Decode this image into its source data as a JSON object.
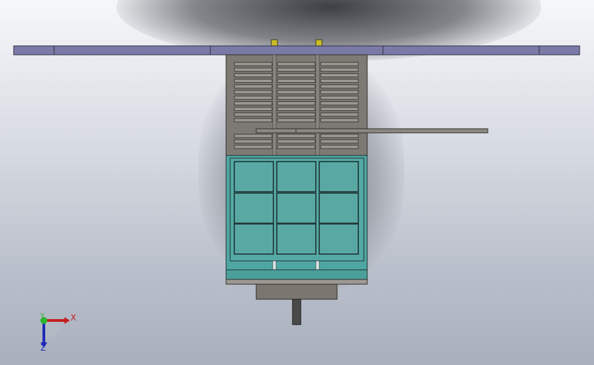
{
  "scene": {
    "type": "cad-model-view",
    "colors": {
      "solar_panel": "#7a7aa6",
      "panel_edge": "#2d2d44",
      "lid": "#7d7a74",
      "vent_slot": "#3b3b3b",
      "teal_body": "#4fa6a2",
      "teal_cell": "#5aa8a4",
      "cell_border": "#1e3332",
      "mount": "#7b7670",
      "connector": "#cbbd2a",
      "shaft": "#4a4a4a"
    },
    "vent_columns": 3,
    "cell_grid": {
      "rows": 3,
      "cols": 3
    }
  },
  "triad": {
    "x_label": "X",
    "y_label": "Y",
    "z_label": "Z",
    "x_color": "#c41f1f",
    "y_color": "#2bb52b",
    "z_color": "#1f2bb8"
  }
}
